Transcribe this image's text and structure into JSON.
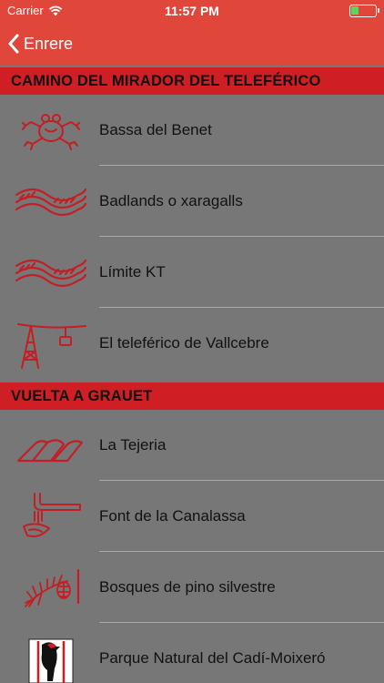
{
  "status_bar": {
    "carrier": "Carrier",
    "time": "11:57 PM",
    "battery_level": 0.3
  },
  "nav": {
    "back_label": "Enrere"
  },
  "sections": [
    {
      "title": "CAMINO DEL MIRADOR DEL TELEFÉRICO",
      "items": [
        {
          "label": "Bassa del Benet",
          "icon": "frog-icon"
        },
        {
          "label": "Badlands o xaragalls",
          "icon": "badlands-icon"
        },
        {
          "label": "Límite KT",
          "icon": "kt-limit-icon"
        },
        {
          "label": "El teleférico de Vallcebre",
          "icon": "cable-car-icon"
        }
      ]
    },
    {
      "title": "VUELTA A GRAUET",
      "items": [
        {
          "label": "La Tejeria",
          "icon": "roof-tile-icon"
        },
        {
          "label": "Font de la Canalassa",
          "icon": "fountain-icon"
        },
        {
          "label": "Bosques de pino silvestre",
          "icon": "pine-branch-icon"
        },
        {
          "label": "Parque Natural del Cadí-Moixeró",
          "icon": "woodpecker-icon"
        }
      ]
    }
  ],
  "colors": {
    "header": "#e0473a",
    "section_bar": "#cf1e24",
    "background": "#777777",
    "icon": "#c41e24"
  }
}
